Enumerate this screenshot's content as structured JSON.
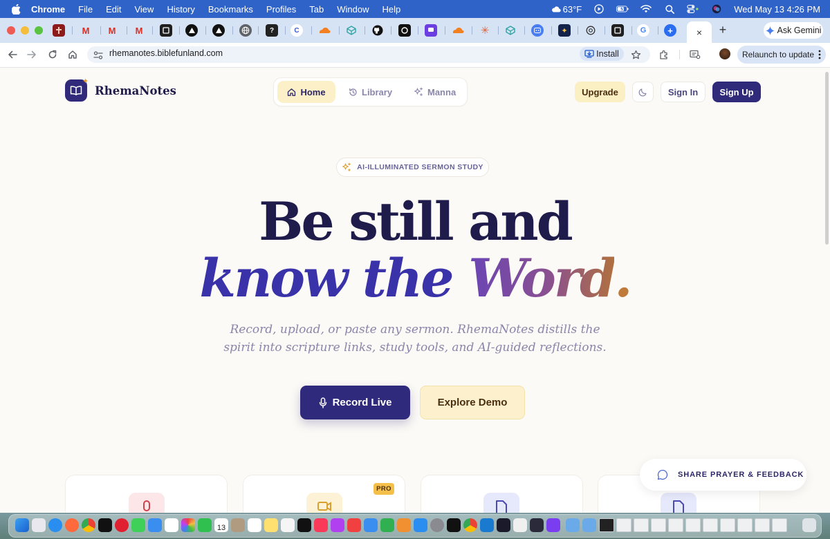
{
  "menubar": {
    "app": "Chrome",
    "items": [
      "File",
      "Edit",
      "View",
      "History",
      "Bookmarks",
      "Profiles",
      "Tab",
      "Window",
      "Help"
    ],
    "weather": "63°F",
    "datetime": "Wed May 13  4:26 PM"
  },
  "browser": {
    "active_tab_close": "×",
    "new_tab": "+",
    "ask_gemini": "Ask Gemini",
    "url": "rhemanotes.biblefunland.com",
    "install": "Install",
    "relaunch": "Relaunch to update"
  },
  "site": {
    "brand": "RhemaNotes",
    "nav": [
      "Home",
      "Library",
      "Manna"
    ],
    "upgrade": "Upgrade",
    "sign_in": "Sign In",
    "sign_up": "Sign Up",
    "eyebrow": "AI-ILLUMINATED SERMON STUDY",
    "headline_line1": "Be still and",
    "headline_word1": "know the",
    "headline_word2": "Word",
    "headline_dot": ".",
    "subtitle_line1": "Record, upload, or paste any sermon. RhemaNotes distills the",
    "subtitle_line2": "spirit into scripture links, study tools, and AI-guided reflections.",
    "record_live": "Record Live",
    "explore_demo": "Explore Demo",
    "pro_badge": "PRO",
    "feedback": "SHARE PRAYER & FEEDBACK"
  },
  "dock": {
    "calendar_day": "13"
  },
  "colors": {
    "brand_indigo": "#2f2a7a",
    "cream_button": "#fcf1cc",
    "page_bg": "#fcfaf6",
    "gradient_end": "#b07040"
  }
}
